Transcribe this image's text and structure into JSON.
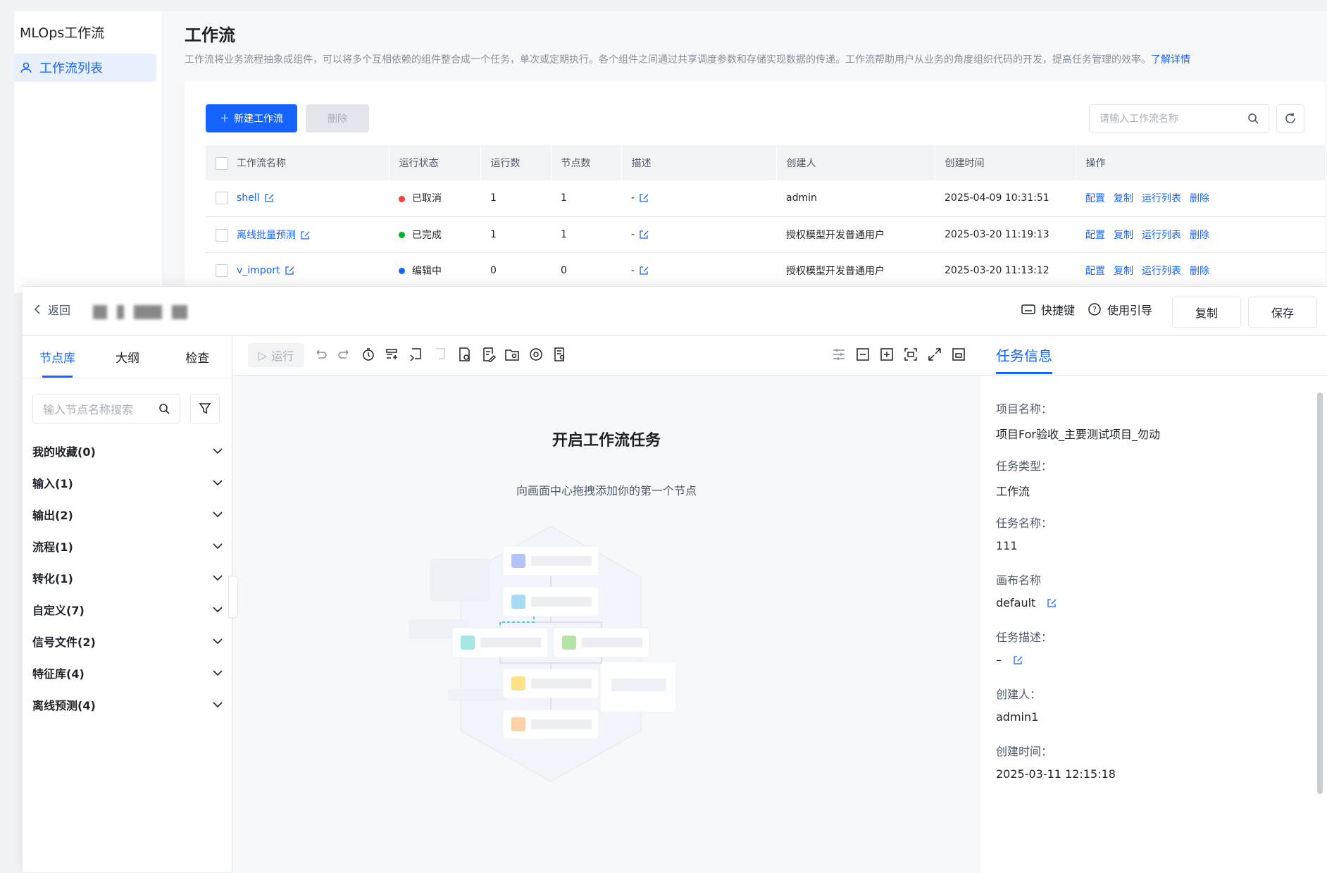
{
  "app_title": "MLOps工作流",
  "sidebar": {
    "items": [
      {
        "label": "工作流列表",
        "icon": "users-icon"
      }
    ]
  },
  "page": {
    "title": "工作流",
    "description": "工作流将业务流程抽象成组件，可以将多个互相依赖的组件整合成一个任务，单次或定期执行。各个组件之间通过共享调度参数和存储实现数据的传递。工作流帮助用户从业务的角度组织代码的开发，提高任务管理的效率。",
    "learn_more": "了解详情",
    "new_button": "新建工作流",
    "delete_button": "删除",
    "search_placeholder": "请输入工作流名称"
  },
  "table": {
    "headers": [
      "工作流名称",
      "运行状态",
      "运行数",
      "节点数",
      "描述",
      "创建人",
      "创建时间",
      "操作"
    ],
    "rows": [
      {
        "name": "shell",
        "status": "已取消",
        "status_color": "#f53f3f",
        "runs": "1",
        "nodes": "1",
        "desc": "-",
        "creator": "admin",
        "created": "2025-04-09 10:31:51"
      },
      {
        "name": "离线批量预测",
        "status": "已完成",
        "status_color": "#00b42a",
        "runs": "1",
        "nodes": "1",
        "desc": "-",
        "creator": "授权模型开发普通用户",
        "created": "2025-03-20 11:19:13"
      },
      {
        "name": "v_import",
        "status": "编辑中",
        "status_color": "#1664ff",
        "runs": "0",
        "nodes": "0",
        "desc": "-",
        "creator": "授权模型开发普通用户",
        "created": "2025-03-20 11:13:12"
      }
    ],
    "ops": [
      "配置",
      "复制",
      "运行列表",
      "删除"
    ]
  },
  "editor": {
    "back": "返回",
    "shortcut": "快捷键",
    "guide": "使用引导",
    "copy": "复制",
    "save": "保存",
    "lib_tabs": [
      "节点库",
      "大纲",
      "检查"
    ],
    "lib_search_placeholder": "输入节点名称搜索",
    "categories": [
      "我的收藏(0)",
      "输入(1)",
      "输出(2)",
      "流程(1)",
      "转化(1)",
      "自定义(7)",
      "信号文件(2)",
      "特征库(4)",
      "离线预测(4)"
    ],
    "run": "运行",
    "canvas_title": "开启工作流任务",
    "canvas_sub": "向画面中心拖拽添加你的第一个节点"
  },
  "info": {
    "tab": "任务信息",
    "fields": [
      {
        "label": "项目名称：",
        "value": "项目For验收_主要测试项目_勿动"
      },
      {
        "label": "任务类型：",
        "value": "工作流"
      },
      {
        "label": "任务名称：",
        "value": "111"
      },
      {
        "label": "画布名称",
        "value": "default"
      },
      {
        "label": "任务描述：",
        "value": "–"
      },
      {
        "label": "创建人：",
        "value": "admin1"
      },
      {
        "label": "创建时间：",
        "value": "2025-03-11 12:15:18"
      }
    ]
  },
  "colors": {
    "accent": "#1664ff"
  }
}
